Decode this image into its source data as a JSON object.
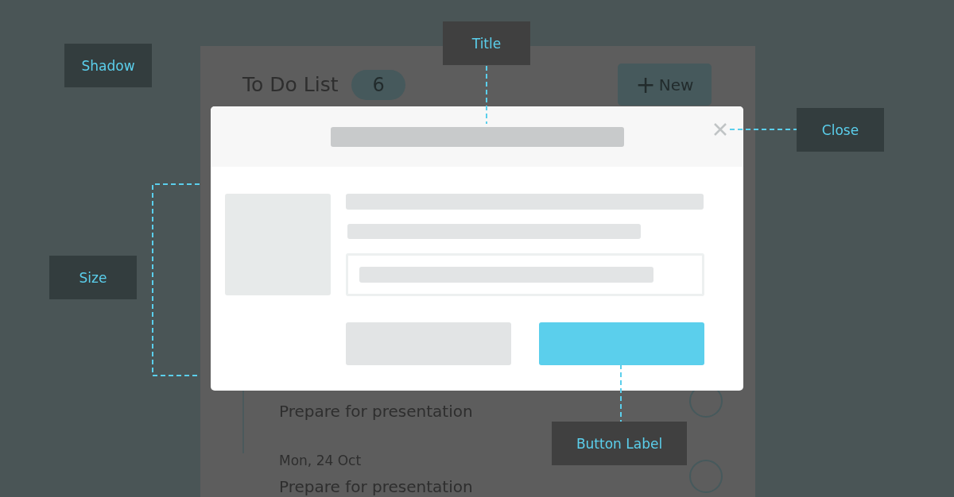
{
  "background_app": {
    "title": "To Do List",
    "count": "6",
    "new_button": {
      "icon": "+",
      "label": "New"
    },
    "items": [
      {
        "kind": "task",
        "text": "Prepare for presentation",
        "checked": false
      },
      {
        "kind": "date",
        "text": "Mon, 24 Oct"
      },
      {
        "kind": "task",
        "text": "Prepare for presentation",
        "checked": false
      }
    ]
  },
  "annotations": [
    {
      "label": "Shadow",
      "kind": "none"
    },
    {
      "label": "Title",
      "kind": "vertical"
    },
    {
      "label": "Close",
      "kind": "horizontal"
    },
    {
      "label": "Size",
      "kind": "bracket"
    },
    {
      "label": "Button Label",
      "kind": "vertical"
    }
  ]
}
